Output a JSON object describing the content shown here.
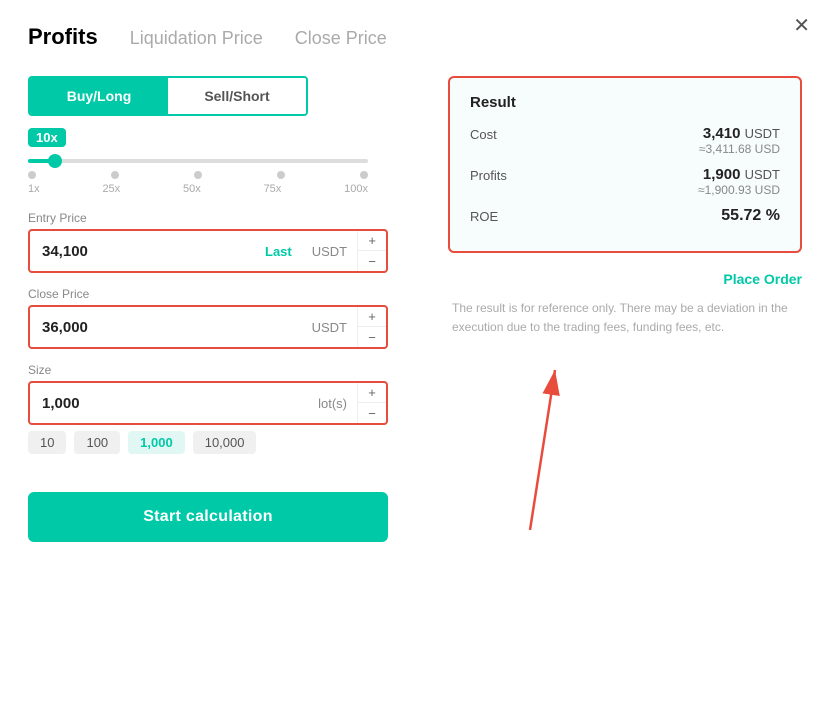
{
  "modal": {
    "close_label": "✕"
  },
  "tabs": [
    {
      "id": "profits",
      "label": "Profits",
      "active": true
    },
    {
      "id": "liquidation",
      "label": "Liquidation Price",
      "active": false
    },
    {
      "id": "close",
      "label": "Close Price",
      "active": false
    }
  ],
  "toggle": {
    "buy_label": "Buy/Long",
    "sell_label": "Sell/Short"
  },
  "leverage": {
    "badge": "10x",
    "labels": [
      "1x",
      "25x",
      "50x",
      "75x",
      "100x"
    ]
  },
  "entry_price": {
    "label": "Entry Price",
    "value": "34,100",
    "unit": "Last",
    "unit2": "USDT"
  },
  "close_price": {
    "label": "Close Price",
    "value": "36,000",
    "unit": "USDT"
  },
  "size": {
    "label": "Size",
    "value": "1,000",
    "unit": "lot(s)",
    "options": [
      "10",
      "100",
      "1,000",
      "10,000"
    ]
  },
  "calc_btn": "Start calculation",
  "result": {
    "title": "Result",
    "cost_label": "Cost",
    "cost_main": "3,410",
    "cost_unit": "USDT",
    "cost_sub": "≈3,411.68 USD",
    "profits_label": "Profits",
    "profits_main": "1,900",
    "profits_unit": "USDT",
    "profits_sub": "≈1,900.93 USD",
    "roe_label": "ROE",
    "roe_val": "55.72",
    "roe_unit": "%",
    "place_order": "Place Order"
  },
  "disclaimer": "The result is for reference only. There may be a deviation in the execution due to the trading fees, funding fees, etc."
}
